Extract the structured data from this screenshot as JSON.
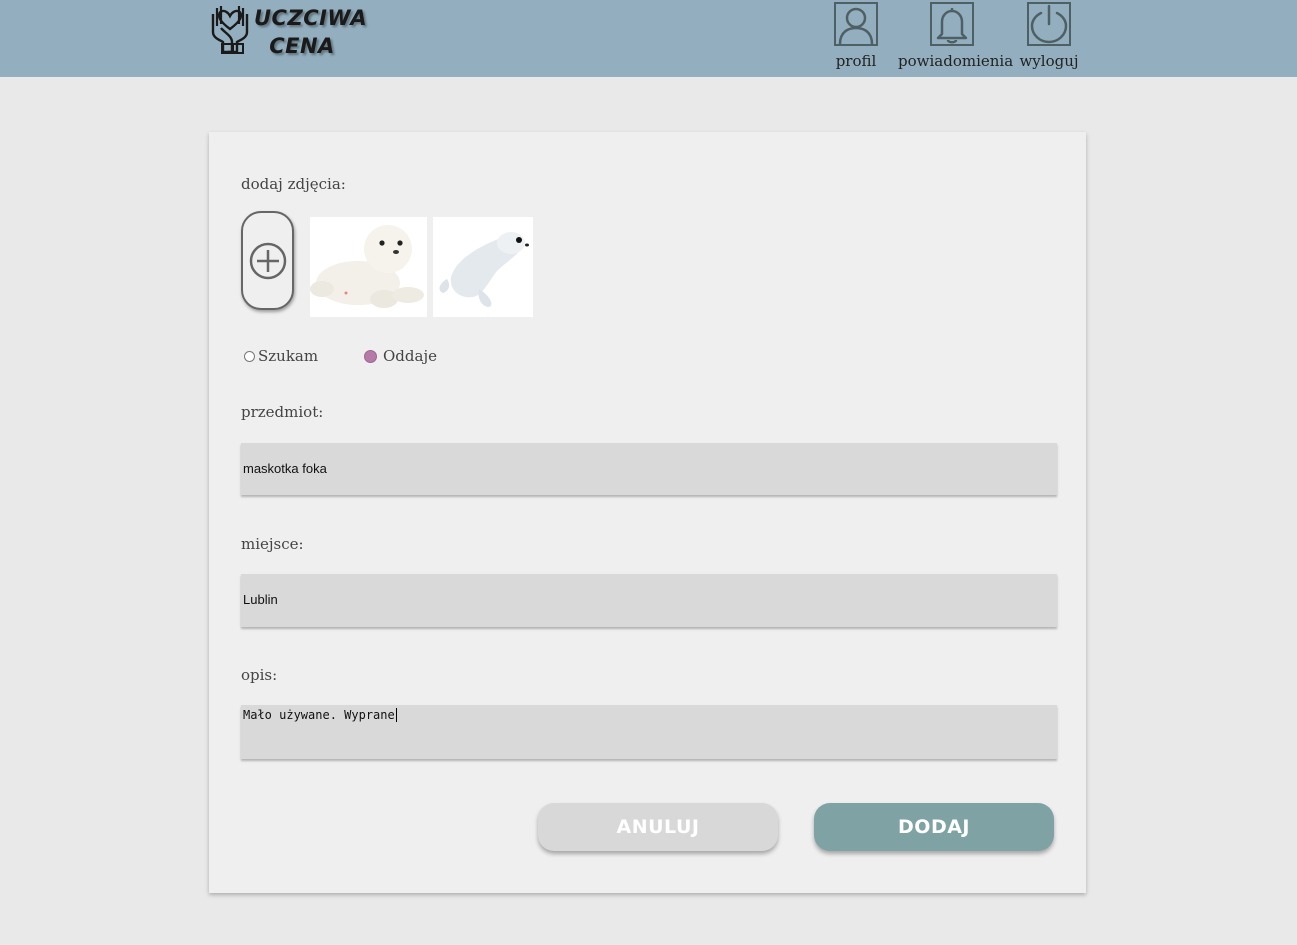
{
  "header": {
    "logo": {
      "line1": "UCZCIWA",
      "line2": "CENA"
    },
    "nav": [
      {
        "label": "profil",
        "icon": "user-icon"
      },
      {
        "label": "powiadomienia",
        "icon": "bell-icon"
      },
      {
        "label": "wyloguj",
        "icon": "power-icon"
      }
    ]
  },
  "form": {
    "photos_label": "dodaj zdjęcia:",
    "add_photo_icon": "plus-circle-icon",
    "photos": [
      {
        "alt": "maskotka foka 1"
      },
      {
        "alt": "maskotka foka 2"
      }
    ],
    "type_options": [
      {
        "label": "Szukam",
        "selected": false
      },
      {
        "label": "Oddaje",
        "selected": true
      }
    ],
    "item_label": "przedmiot:",
    "item_value": "maskotka foka",
    "place_label": "miejsce:",
    "place_value": "Lublin",
    "description_label": "opis:",
    "description_value": "Mało używane. Wyprane",
    "cancel_label": "ANULUJ",
    "submit_label": "DODAJ"
  },
  "colors": {
    "header_bg": "#93afbf",
    "page_bg": "#e9e9e9",
    "card_bg": "#efefef",
    "field_bg": "#d9d9d9",
    "submit_bg": "#7fa3a4",
    "cancel_bg": "#d8d8d8",
    "radio_selected": "#b57aa7"
  }
}
